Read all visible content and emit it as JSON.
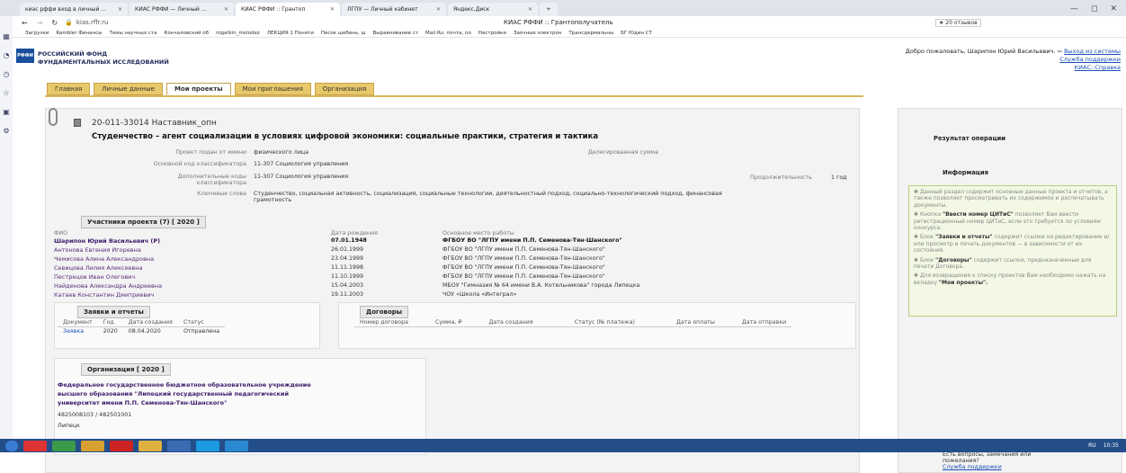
{
  "browser": {
    "tabs": [
      {
        "label": "киас рффи вход в личный ..."
      },
      {
        "label": "КИАС РФФИ — Личный ..."
      },
      {
        "label": "КИАС РФФИ :: Грантоп"
      },
      {
        "label": "ЛГПУ — Личный кабинет"
      },
      {
        "label": "Яндекс.Диск"
      }
    ],
    "new_tab": "+",
    "url": "kias.rffr.ru",
    "page_title": "КИАС РФФИ :: Грантополучатель",
    "reviews": "★ 20 отзывов",
    "bookmarks": [
      "Загрузки",
      "Rambler Финансы",
      "Темы научных ста",
      "Кончаловский об",
      "rogatkin_molodez",
      "ЛЕКЦИЯ 1 Поняти",
      "Песок щебень, ш",
      "Выравнивание ст",
      "Mail.Ru: почта, по",
      "Настройки",
      "Заочные электрон",
      "Трансдермальны",
      "БГ Юдин СТ"
    ]
  },
  "header": {
    "logo": "РФФИ",
    "org_line1": "РОССИЙСКИЙ ФОНД",
    "org_line2": "ФУНДАМЕНТАЛЬНЫХ ИССЛЕДОВАНИЙ",
    "welcome": "Добро пожаловать, Шарипон Юрий Васильевич.",
    "logout": "Выход из системы",
    "support": "Служба поддержки",
    "help": "КИАС::Справка"
  },
  "nav": {
    "tabs": [
      "Главная",
      "Личные данные",
      "Мои проекты",
      "Мои приглашения",
      "Организация"
    ]
  },
  "project": {
    "number": "20-011-33014 Наставник_опн",
    "title": "Студенчество – агент социализации в условиях цифровой экономики: социальные практики, стратегия и тактика",
    "submitted_label": "Проект подан от имени",
    "submitted_value": "физического лица",
    "delegated_label": "Делегированная сумма",
    "main_code_label": "Основной код классификатора",
    "main_code_value": "11-307 Социология управления",
    "extra_code_label1": "Дополнительные коды",
    "extra_code_label2": "классификатора",
    "extra_code_value": "11-307 Социология управления",
    "duration_label": "Продолжительность",
    "duration_value": "1 год",
    "keywords_label": "Ключевые слова",
    "keywords_line1": "Студенчество, социальная активность, социализация, социальные технологии, деятельностный подход, социально-технологический подход, финансовая",
    "keywords_line2": "грамотность"
  },
  "participants": {
    "title": "Участники проекта (7) [ 2020 ]",
    "col_fio": "ФИО",
    "col_birth": "Дата рождения",
    "col_work": "Основное место работы",
    "rows": [
      {
        "name": "Шарипон Юрий Васильевич (Р)",
        "birth": "07.01.1948",
        "work": "ФГБОУ ВО \"ЛГПУ имени П.П. Семенова-Тян-Шанского\""
      },
      {
        "name": "Антонова Евгения Игоревна",
        "birth": "26.01.1999",
        "work": "ФГБОУ ВО \"ЛГПУ имени П.П. Семенова-Тян-Шанского\""
      },
      {
        "name": "Чемисова Алина Александровна",
        "birth": "23.04.1999",
        "work": "ФГБОУ ВО \"ЛГПУ имени П.П. Семенова-Тян-Шанского\""
      },
      {
        "name": "Севицова Лилия Алексеевна",
        "birth": "11.11.1998",
        "work": "ФГБОУ ВО \"ЛГПУ имени П.П. Семенова-Тян-Шанского\""
      },
      {
        "name": "Пестрецов Иван Олегович",
        "birth": "11.10.1999",
        "work": "ФГБОУ ВО \"ЛГПУ имени П.П. Семенова-Тян-Шанского\""
      },
      {
        "name": "Найденова Александра Андреевна",
        "birth": "15.04.2003",
        "work": "МБОУ \"Гимназия № 64 имени В.А. Котельникова\" города Липецка"
      },
      {
        "name": "Катаев Константин Дмитриевич",
        "birth": "19.11.2003",
        "work": "ЧОУ «Школа «Интеграл»"
      }
    ]
  },
  "requests": {
    "title": "Заявки и отчеты",
    "cols": [
      "Документ",
      "Год",
      "Дата создания",
      "Статус"
    ],
    "row": {
      "doc": "Заявка",
      "year": "2020",
      "date": "08.04.2020",
      "status": "Отправлена"
    }
  },
  "contracts": {
    "title": "Договоры",
    "cols": [
      "Номер договора",
      "Сумма, ₽",
      "Дата создания",
      "Статус (№ платежа)",
      "Дата оплаты",
      "Дата отправки"
    ]
  },
  "organization": {
    "title": "Организация [ 2020 ]",
    "line1": "Федеральное государственное бюджетное образовательное учреждение",
    "line2": "высшего образования \"Липецкий государственный педагогический",
    "line3": "университет имени П.П. Семенова-Тян-Шанского\"",
    "codes": "4825008103 / 482501001",
    "city": "Липецк"
  },
  "right": {
    "result_title": "Результат операции",
    "info_title": "Информация",
    "p1": "Данный раздел содержит основные данные проекта и отчетов, а также позволяет просматривать их содержимое и распечатывать документы.",
    "p2a": "Кнопка",
    "p2b": "\"Ввести номер ЦИТиС\"",
    "p2c": "позволяет Вам ввести регистрационный номер ЦИТиС, если это требуется по условиям конкурса.",
    "p3a": "Блок",
    "p3b": "\"Заявки и отчеты\"",
    "p3c": "содержит ссылки на редактирование и/или просмотр и печать документов — в зависимости от их состояния.",
    "p4a": "Блок",
    "p4b": "\"Договоры\"",
    "p4c": "содержит ссылки, предназначенные для печати Договора.",
    "p5a": "Для возвращения к списку проектов Вам необходимо нажать на вкладку",
    "p5b": "\"Мои проекты\".",
    "q1": "Есть вопросы, замечания или",
    "q2": "пожелания?",
    "q_link": "Служба поддержки"
  },
  "taskbar": {
    "lang": "RU",
    "time": "10:35"
  }
}
